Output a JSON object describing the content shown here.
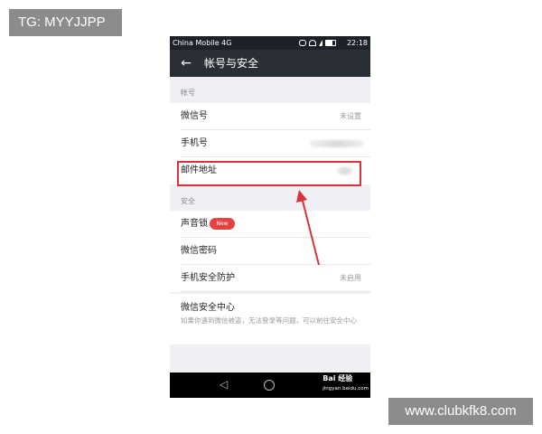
{
  "watermark_top_left": "TG: MYYJJPP",
  "watermark_bottom_right": "www.clubkfk8.com",
  "status_bar": {
    "carrier": "China Mobile 4G",
    "time": "22:18"
  },
  "app_bar": {
    "back_icon": "back-arrow-icon",
    "title": "帐号与安全"
  },
  "sections": {
    "account": {
      "header": "帐号",
      "items": [
        {
          "label": "微信号",
          "value": "未设置"
        },
        {
          "label": "手机号",
          "value": ""
        },
        {
          "label": "邮件地址",
          "value": ""
        }
      ]
    },
    "security": {
      "header": "安全",
      "items": [
        {
          "label": "声音锁",
          "badge": "New"
        },
        {
          "label": "微信密码"
        },
        {
          "label": "手机安全防护",
          "value": "未启用"
        }
      ],
      "security_center": {
        "title": "微信安全中心",
        "description": "如果你遇到微信被盗，无法登录等问题，可以前往安全中心"
      }
    }
  },
  "nav_bar": {
    "back_glyph": "◁",
    "watermark_brand": "Bai 经验",
    "watermark_url": "jingyan.baidu.com"
  },
  "colors": {
    "app_bar": "#2a2f35",
    "highlight": "#d9333a",
    "badge": "#e64340"
  }
}
